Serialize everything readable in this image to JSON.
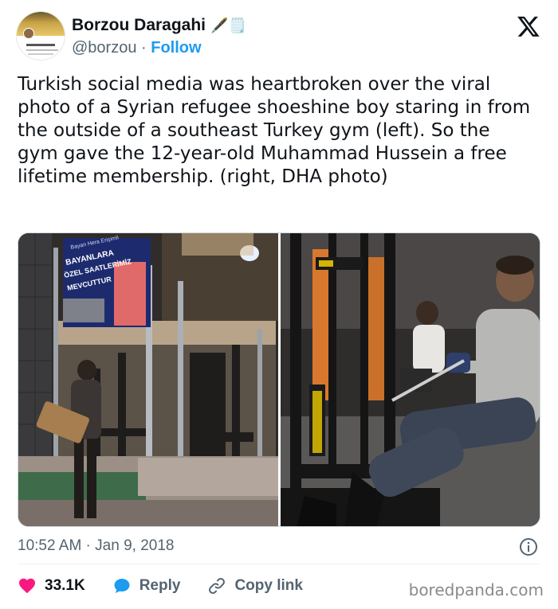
{
  "author": {
    "display_name": "Borzou Daragahi",
    "name_emoji": "🖋️🗒️",
    "handle": "@borzou",
    "separator": " · ",
    "follow_label": "Follow"
  },
  "tweet": {
    "text": "Turkish social media was heartbroken over the viral photo of a Syrian refugee shoeshine boy staring in from the outside of a southeast Turkey gym (left). So the gym gave the 12-year-old Muhammad Hussein a free lifetime membership. (right, DHA photo)"
  },
  "media": {
    "left_photo": {
      "sign_lines": [
        "Bayan Hera Erişimli",
        "BAYANLARA",
        "ÖZEL SAATLERİMİZ",
        "MEVCUTTUR"
      ]
    }
  },
  "meta": {
    "time": "10:52 AM",
    "separator": " · ",
    "date": "Jan 9, 2018"
  },
  "actions": {
    "like_count": "33.1K",
    "reply_label": "Reply",
    "copy_label": "Copy link"
  },
  "brand": "boredpanda.com",
  "colors": {
    "accent": "#1d9bf0",
    "like": "#f91880",
    "text": "#0f1419",
    "muted": "#536471"
  }
}
